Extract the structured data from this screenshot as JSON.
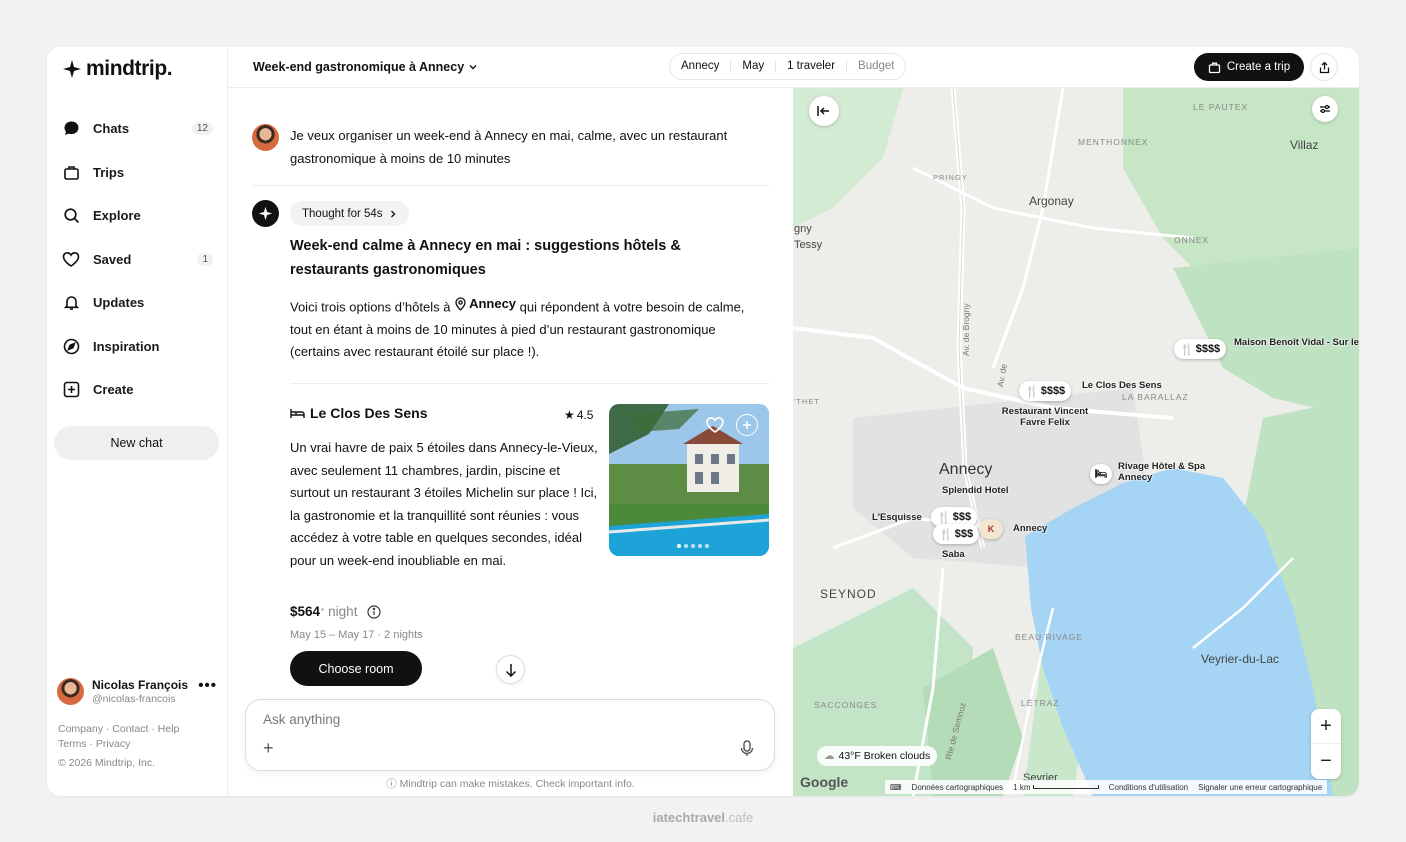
{
  "app": {
    "logo_text": "mindtrip."
  },
  "sidebar": {
    "items": [
      {
        "label": "Chats",
        "count": "12",
        "icon": "chat-bubble-icon"
      },
      {
        "label": "Trips",
        "count": "",
        "icon": "suitcase-icon"
      },
      {
        "label": "Explore",
        "count": "",
        "icon": "search-icon"
      },
      {
        "label": "Saved",
        "count": "1",
        "icon": "heart-icon"
      },
      {
        "label": "Updates",
        "count": "",
        "icon": "bell-icon"
      },
      {
        "label": "Inspiration",
        "count": "",
        "icon": "compass-icon"
      },
      {
        "label": "Create",
        "count": "",
        "icon": "plus-square-icon"
      }
    ],
    "new_chat": "New chat",
    "user": {
      "name": "Nicolas François",
      "handle": "@nicolas-francois"
    },
    "footer_line1": "Company · Contact · Help",
    "footer_line2": "Terms · Privacy",
    "copyright": "© 2026 Mindtrip, Inc."
  },
  "topbar": {
    "trip_title": "Week-end gastronomique à Annecy",
    "filters": [
      "Annecy",
      "May",
      "1 traveler",
      "Budget"
    ],
    "create_trip": "Create a trip"
  },
  "chat": {
    "user_message": "Je veux organiser un week-end à Annecy en mai, calme, avec un restaurant gastronomique à moins de 10 minutes",
    "thought": "Thought for 54s",
    "ai_title": "Week-end calme à Annecy en mai : suggestions hôtels & restaurants gastronomiques",
    "ai_body_pre": "Voici trois options d’hôtels à",
    "ai_body_loc": "Annecy",
    "ai_body_post": "qui répondent à votre besoin de calme, tout en étant à moins de 10 minutes à pied d’un restaurant gastronomique (certains avec restaurant étoilé sur place !).",
    "hotel": {
      "name": "Le Clos Des Sens",
      "rating": "4.5",
      "description": "Un vrai havre de paix 5 étoiles dans Annecy-le-Vieux, avec seulement 11 chambres, jardin, piscine et surtout un restaurant 3 étoiles Michelin sur place ! Ici, la gastronomie et la tranquillité sont réunies : vous accédez à votre table en quelques secondes, idéal pour un week-end inoubliable en mai.",
      "price": "$564",
      "price_sup": "*",
      "price_unit": "night",
      "dates": "May 15 – May 17 · 2 nights",
      "choose": "Choose room",
      "photo_dots": 5
    },
    "composer_placeholder": "Ask anything",
    "disclaimer": "Mindtrip can make mistakes. Check important info."
  },
  "map": {
    "places": [
      "Villaz",
      "Argonay",
      "gny",
      "Tessy",
      "Annecy",
      "SEYNOD",
      "Veyrier-du-Lac",
      "Sevrier"
    ],
    "districts": [
      "LE PAUTEX",
      "MENTHONNEX",
      "PRINGY",
      "ONNEX",
      "LA BARALLAZ",
      "BEAU RIVAGE",
      "SACCONGES",
      "LÉTRAZ",
      "'THET"
    ],
    "streets": [
      "Av. de Brogny",
      "Av. de",
      "Rte de Semnoz"
    ],
    "pois": [
      {
        "name": "Maison Benoît Vidal - Sur les Bois",
        "price": "$$$$"
      },
      {
        "name": "Le Clos Des Sens"
      },
      {
        "name": "Restaurant Vincent Favre Felix",
        "price": "$$$$"
      },
      {
        "name": "Rivage Hôtel & Spa Annecy"
      },
      {
        "name": "Splendid Hotel"
      },
      {
        "name": "L'Esquisse",
        "price": "$$$"
      },
      {
        "name": "Saba",
        "price": "$$$"
      },
      {
        "name": "Annecy"
      }
    ],
    "weather": "43°F Broken clouds",
    "google": "Google",
    "attribution": [
      "Données cartographiques",
      "1 km",
      "Conditions d'utilisation",
      "Signaler une erreur cartographique"
    ],
    "colors": {
      "water": "#a5d4f5",
      "forest": "#c3e4c6",
      "urban": "#e4e4e4"
    }
  },
  "watermark": {
    "brand": "iatechtravel",
    "suffix": ".cafe"
  }
}
